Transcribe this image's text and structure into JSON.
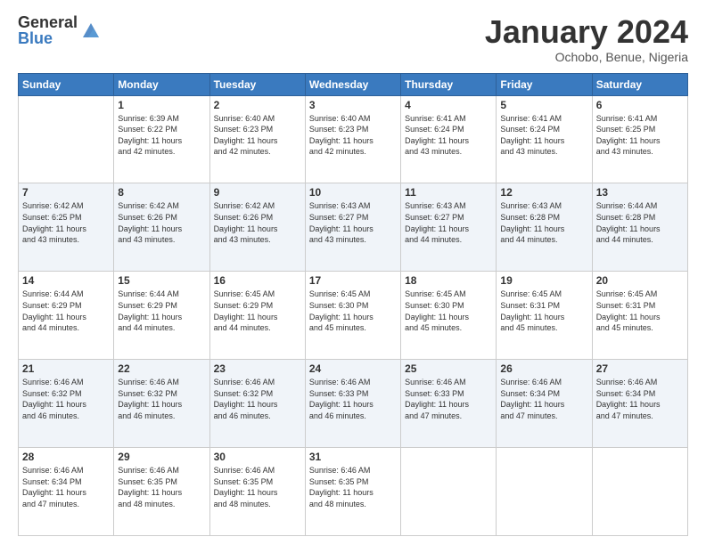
{
  "logo": {
    "general": "General",
    "blue": "Blue"
  },
  "header": {
    "month": "January 2024",
    "location": "Ochobo, Benue, Nigeria"
  },
  "weekdays": [
    "Sunday",
    "Monday",
    "Tuesday",
    "Wednesday",
    "Thursday",
    "Friday",
    "Saturday"
  ],
  "weeks": [
    [
      {
        "day": "",
        "content": ""
      },
      {
        "day": "1",
        "content": "Sunrise: 6:39 AM\nSunset: 6:22 PM\nDaylight: 11 hours\nand 42 minutes."
      },
      {
        "day": "2",
        "content": "Sunrise: 6:40 AM\nSunset: 6:23 PM\nDaylight: 11 hours\nand 42 minutes."
      },
      {
        "day": "3",
        "content": "Sunrise: 6:40 AM\nSunset: 6:23 PM\nDaylight: 11 hours\nand 42 minutes."
      },
      {
        "day": "4",
        "content": "Sunrise: 6:41 AM\nSunset: 6:24 PM\nDaylight: 11 hours\nand 43 minutes."
      },
      {
        "day": "5",
        "content": "Sunrise: 6:41 AM\nSunset: 6:24 PM\nDaylight: 11 hours\nand 43 minutes."
      },
      {
        "day": "6",
        "content": "Sunrise: 6:41 AM\nSunset: 6:25 PM\nDaylight: 11 hours\nand 43 minutes."
      }
    ],
    [
      {
        "day": "7",
        "content": "Sunrise: 6:42 AM\nSunset: 6:25 PM\nDaylight: 11 hours\nand 43 minutes."
      },
      {
        "day": "8",
        "content": "Sunrise: 6:42 AM\nSunset: 6:26 PM\nDaylight: 11 hours\nand 43 minutes."
      },
      {
        "day": "9",
        "content": "Sunrise: 6:42 AM\nSunset: 6:26 PM\nDaylight: 11 hours\nand 43 minutes."
      },
      {
        "day": "10",
        "content": "Sunrise: 6:43 AM\nSunset: 6:27 PM\nDaylight: 11 hours\nand 43 minutes."
      },
      {
        "day": "11",
        "content": "Sunrise: 6:43 AM\nSunset: 6:27 PM\nDaylight: 11 hours\nand 44 minutes."
      },
      {
        "day": "12",
        "content": "Sunrise: 6:43 AM\nSunset: 6:28 PM\nDaylight: 11 hours\nand 44 minutes."
      },
      {
        "day": "13",
        "content": "Sunrise: 6:44 AM\nSunset: 6:28 PM\nDaylight: 11 hours\nand 44 minutes."
      }
    ],
    [
      {
        "day": "14",
        "content": "Sunrise: 6:44 AM\nSunset: 6:29 PM\nDaylight: 11 hours\nand 44 minutes."
      },
      {
        "day": "15",
        "content": "Sunrise: 6:44 AM\nSunset: 6:29 PM\nDaylight: 11 hours\nand 44 minutes."
      },
      {
        "day": "16",
        "content": "Sunrise: 6:45 AM\nSunset: 6:29 PM\nDaylight: 11 hours\nand 44 minutes."
      },
      {
        "day": "17",
        "content": "Sunrise: 6:45 AM\nSunset: 6:30 PM\nDaylight: 11 hours\nand 45 minutes."
      },
      {
        "day": "18",
        "content": "Sunrise: 6:45 AM\nSunset: 6:30 PM\nDaylight: 11 hours\nand 45 minutes."
      },
      {
        "day": "19",
        "content": "Sunrise: 6:45 AM\nSunset: 6:31 PM\nDaylight: 11 hours\nand 45 minutes."
      },
      {
        "day": "20",
        "content": "Sunrise: 6:45 AM\nSunset: 6:31 PM\nDaylight: 11 hours\nand 45 minutes."
      }
    ],
    [
      {
        "day": "21",
        "content": "Sunrise: 6:46 AM\nSunset: 6:32 PM\nDaylight: 11 hours\nand 46 minutes."
      },
      {
        "day": "22",
        "content": "Sunrise: 6:46 AM\nSunset: 6:32 PM\nDaylight: 11 hours\nand 46 minutes."
      },
      {
        "day": "23",
        "content": "Sunrise: 6:46 AM\nSunset: 6:32 PM\nDaylight: 11 hours\nand 46 minutes."
      },
      {
        "day": "24",
        "content": "Sunrise: 6:46 AM\nSunset: 6:33 PM\nDaylight: 11 hours\nand 46 minutes."
      },
      {
        "day": "25",
        "content": "Sunrise: 6:46 AM\nSunset: 6:33 PM\nDaylight: 11 hours\nand 47 minutes."
      },
      {
        "day": "26",
        "content": "Sunrise: 6:46 AM\nSunset: 6:34 PM\nDaylight: 11 hours\nand 47 minutes."
      },
      {
        "day": "27",
        "content": "Sunrise: 6:46 AM\nSunset: 6:34 PM\nDaylight: 11 hours\nand 47 minutes."
      }
    ],
    [
      {
        "day": "28",
        "content": "Sunrise: 6:46 AM\nSunset: 6:34 PM\nDaylight: 11 hours\nand 47 minutes."
      },
      {
        "day": "29",
        "content": "Sunrise: 6:46 AM\nSunset: 6:35 PM\nDaylight: 11 hours\nand 48 minutes."
      },
      {
        "day": "30",
        "content": "Sunrise: 6:46 AM\nSunset: 6:35 PM\nDaylight: 11 hours\nand 48 minutes."
      },
      {
        "day": "31",
        "content": "Sunrise: 6:46 AM\nSunset: 6:35 PM\nDaylight: 11 hours\nand 48 minutes."
      },
      {
        "day": "",
        "content": ""
      },
      {
        "day": "",
        "content": ""
      },
      {
        "day": "",
        "content": ""
      }
    ]
  ]
}
